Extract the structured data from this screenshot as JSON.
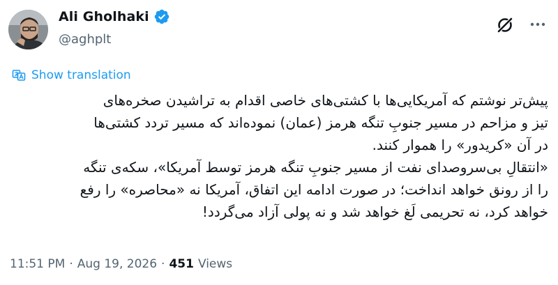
{
  "author": {
    "name": "Ali Gholhaki",
    "handle": "@aghplt",
    "verified": true,
    "verified_color": "#1d9bf0"
  },
  "actions": {
    "grok_icon": "grok-icon",
    "more_icon": "more-icon"
  },
  "translation": {
    "label": "Show translation",
    "color": "#1d9bf0"
  },
  "post": {
    "lines": [
      "پیش‌تر نوشتم که آمریکایی‌ها با کشتی‌های خاصی اقدام به تراشیدن صخره‌های",
      "تیز و مزاحم در مسیر جنوبِ تنگه هرمز (عمان) نموده‌اند که مسیر تردد کشتی‌ها",
      "در آن «کریدور» را هموار کنند.",
      "«انتقالِ بی‌سروصدای نفت از مسیر جنوبِ تنگه هرمز توسط آمریکا»، سکه‌ی تنگه",
      "را از رونق خواهد انداخت؛ در صورت ادامه این اتفاق، آمریکا نه «محاصره» را رفع",
      "خواهد کرد، نه تحریمی لَغ خواهد شد و نه پولی آزاد می‌گردد!"
    ]
  },
  "meta": {
    "time": "11:51 PM",
    "separator1": "·",
    "date": "Aug 19, 2026",
    "separator2": "·",
    "views_count": "451",
    "views_label": "Views"
  }
}
